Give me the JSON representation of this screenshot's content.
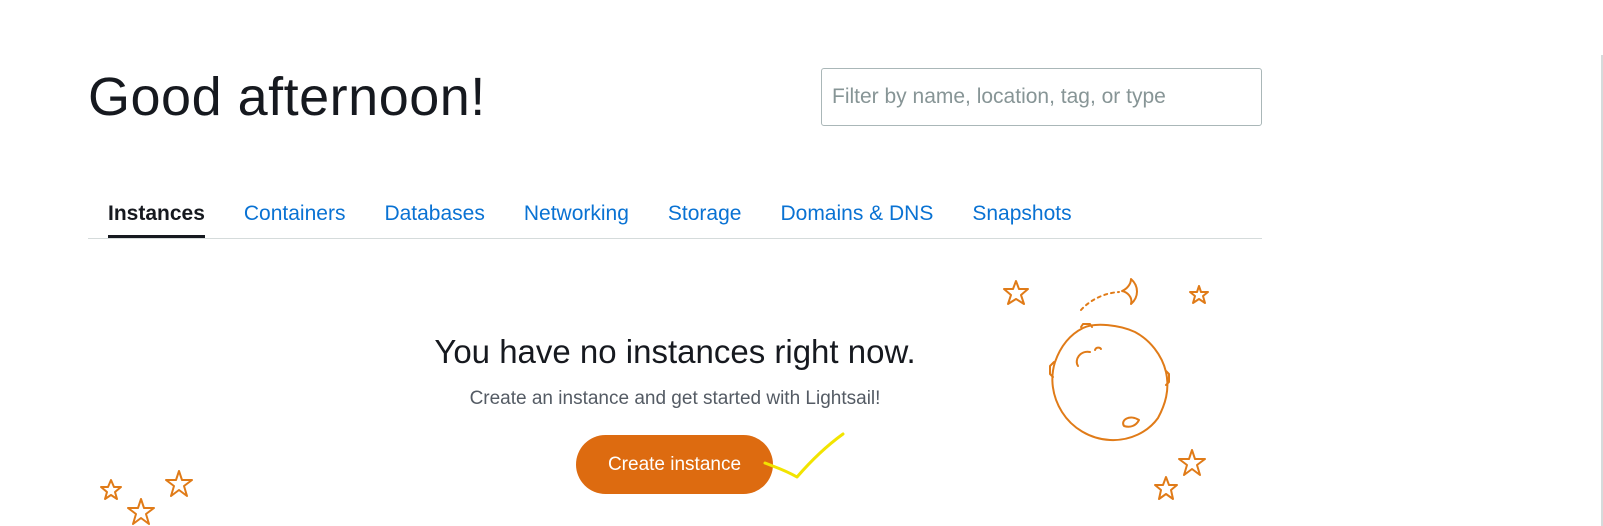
{
  "greeting": "Good afternoon!",
  "search": {
    "placeholder": "Filter by name, location, tag, or type",
    "value": ""
  },
  "tabs": [
    {
      "label": "Instances",
      "active": true
    },
    {
      "label": "Containers",
      "active": false
    },
    {
      "label": "Databases",
      "active": false
    },
    {
      "label": "Networking",
      "active": false
    },
    {
      "label": "Storage",
      "active": false
    },
    {
      "label": "Domains & DNS",
      "active": false
    },
    {
      "label": "Snapshots",
      "active": false
    }
  ],
  "empty_state": {
    "title": "You have no instances right now.",
    "subtitle": "Create an instance and get started with Lightsail!",
    "button_label": "Create instance"
  },
  "colors": {
    "accent": "#dd6b10",
    "link": "#0972d3",
    "illustration": "#e07b18",
    "annotation": "#f2e400"
  },
  "icons": [
    "star-icon",
    "planet-icon",
    "moon-icon",
    "checkmark-annotation"
  ]
}
